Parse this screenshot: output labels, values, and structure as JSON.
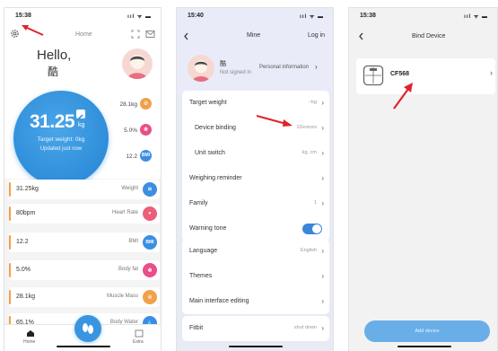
{
  "screen_home": {
    "status_time": "15:38",
    "status_indicators": "ııl ᯤ ▬",
    "nav_title": "Home",
    "greeting": "Hello,",
    "username": "酷",
    "weight_value": "31.25",
    "weight_unit": "kg",
    "target_weight": "Target weight: 0kg",
    "updated": "Updated just now",
    "mini_stats": [
      {
        "value": "28.1kg",
        "icon": "muscle-icon",
        "color": "#f0a14a"
      },
      {
        "value": "5.0%",
        "icon": "body-fat-icon",
        "color": "#e94f8a"
      },
      {
        "value": "12.2",
        "icon": "BMI",
        "color": "#3b8ee4"
      }
    ],
    "metrics": [
      {
        "value": "31.25kg",
        "name": "Weight",
        "color": "#3b8ee4",
        "icon": "weight-icon"
      },
      {
        "value": "80bpm",
        "name": "Heart Rate",
        "color": "#ec5e7b",
        "icon": "heart-rate-icon"
      },
      {
        "value": "12.2",
        "name": "BMI",
        "color": "#3b8ee4",
        "icon": "BMI"
      },
      {
        "value": "5.0%",
        "name": "Body fat",
        "color": "#e94f8a",
        "icon": "body-fat-icon"
      },
      {
        "value": "28.1kg",
        "name": "Muscle Mass",
        "color": "#f0a14a",
        "icon": "muscle-icon"
      },
      {
        "value": "65.1%",
        "name": "Body Water",
        "color": "#3b8ee4",
        "icon": "water-icon"
      }
    ],
    "tabs": {
      "home": "Home",
      "extra": "Extra"
    }
  },
  "screen_mine": {
    "status_time": "15:40",
    "status_indicators": "ııl ᯤ ▬",
    "title": "Mine",
    "login": "Log in",
    "name": "酷",
    "not_signed_in": "Not signed in",
    "personal_info": "Personal information",
    "group1": [
      {
        "label": "Target weight",
        "value": "--kg"
      },
      {
        "label": "Device binding",
        "value": "1Devices"
      },
      {
        "label": "Unit switch",
        "value": "kg, cm"
      },
      {
        "label": "Weighing reminder",
        "value": ""
      },
      {
        "label": "Family",
        "value": "1"
      },
      {
        "label": "Warning tone",
        "value": ""
      }
    ],
    "group2": [
      {
        "label": "Language",
        "value": "English"
      },
      {
        "label": "Themes",
        "value": ""
      },
      {
        "label": "Main interface editing",
        "value": ""
      }
    ],
    "group3": [
      {
        "label": "Fitbit",
        "value": "shut down"
      }
    ]
  },
  "screen_bind": {
    "status_time": "15:38",
    "status_indicators": "ııl ᯤ ▬",
    "title": "Bind Device",
    "device_name": "CF568",
    "add_device": "Add device"
  },
  "colors": {
    "accent_blue": "#2383d4",
    "annotation_red": "#e0232b"
  }
}
